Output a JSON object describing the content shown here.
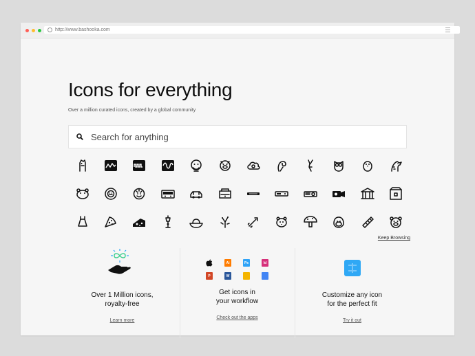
{
  "browser": {
    "url": "http://www.bashooka.com",
    "traffic_lights": [
      "#ff5f57",
      "#ffbd2e",
      "#28c840"
    ]
  },
  "hero": {
    "title": "Icons for everything",
    "subtitle": "Over a million curated icons, created by a global community"
  },
  "search": {
    "placeholder": "Search for anything"
  },
  "icon_grid": {
    "rows": [
      [
        "horse-icon",
        "square-wave-icon",
        "pulse-wave-icon",
        "sine-wave-icon",
        "chimp-icon",
        "pig-icon",
        "cloud-icon",
        "parrot-icon",
        "kangaroo-icon",
        "owl-icon",
        "penguin-icon",
        "giraffe-icon"
      ],
      [
        "hamster-icon",
        "lion-icon",
        "tiger-icon",
        "radio-icon",
        "car-icon",
        "machine-icon",
        "module-icon",
        "receiver-icon",
        "projector-icon",
        "camera-icon",
        "temple-icon",
        "box-icon"
      ],
      [
        "dress-icon",
        "pizza-icon",
        "cheese-icon",
        "lamp-icon",
        "bowl-icon",
        "sketch-icon",
        "rocket-icon",
        "hamster-face-icon",
        "mushroom-icon",
        "gorilla-icon",
        "ruler-icon",
        "bear-icon"
      ]
    ]
  },
  "keep_browsing": "Keep Browsing",
  "features": [
    {
      "title_line1": "Over 1 Million icons,",
      "title_line2": "royalty-free",
      "link": "Learn more"
    },
    {
      "title_line1": "Get icons in",
      "title_line2": "your workflow",
      "link": "Check out the apps"
    },
    {
      "title_line1": "Customize any icon",
      "title_line2": "for the perfect fit",
      "link": "Try it out"
    }
  ],
  "apps": [
    {
      "name": "apple-icon",
      "color": "#111111",
      "label": ""
    },
    {
      "name": "illustrator-icon",
      "color": "#ff7c00",
      "label": "Ai"
    },
    {
      "name": "photoshop-icon",
      "color": "#2fa3f7",
      "label": "Ps"
    },
    {
      "name": "indesign-icon",
      "color": "#d6307a",
      "label": "Id"
    },
    {
      "name": "powerpoint-icon",
      "color": "#d24726",
      "label": "P"
    },
    {
      "name": "word-icon",
      "color": "#2b579a",
      "label": "W"
    },
    {
      "name": "slides-icon",
      "color": "#f4b400",
      "label": ""
    },
    {
      "name": "docs-icon",
      "color": "#4285f4",
      "label": ""
    }
  ],
  "colors": {
    "accent_green": "#3ecf8e",
    "accent_blue": "#2fa8f5"
  }
}
